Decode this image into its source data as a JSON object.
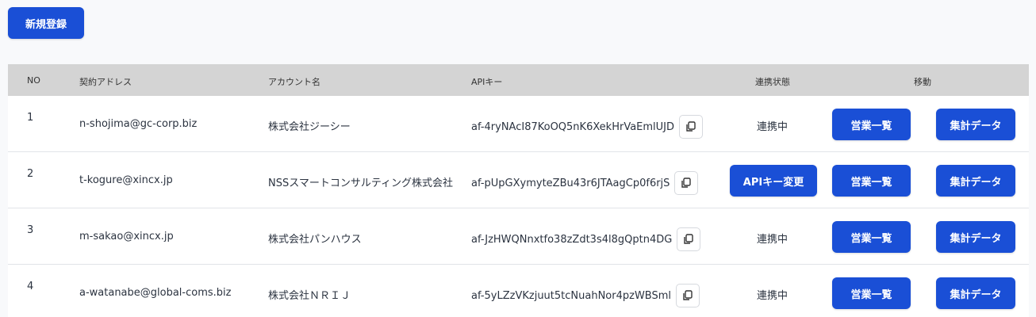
{
  "toolbar": {
    "new_label": "新規登録"
  },
  "colors": {
    "accent": "#1a4fd6",
    "header_bg": "#d4d4d4"
  },
  "table": {
    "headers": {
      "no": "NO",
      "email": "契約アドレス",
      "account": "アカウント名",
      "api": "APIキー",
      "status": "連携状態",
      "move": "移動"
    },
    "rows": [
      {
        "no": "1",
        "email": "n-shojima@gc-corp.biz",
        "account": "株式会社ジーシー",
        "api": "af-4ryNAcI87KoOQ5nK6XekHrVaEmlUJD",
        "status": "連携中",
        "sales": "営業一覧",
        "agg": "集計データ"
      },
      {
        "no": "2",
        "email": "t-kogure@xincx.jp",
        "account": "NSSスマートコンサルティング株式会社",
        "api": "af-pUpGXymyteZBu43r6JTAagCp0f6rjS",
        "api_change": "APIキー変更",
        "sales": "営業一覧",
        "agg": "集計データ"
      },
      {
        "no": "3",
        "email": "m-sakao@xincx.jp",
        "account": "株式会社パンハウス",
        "api": "af-JzHWQNnxtfo38zZdt3s4l8gQptn4DG",
        "status": "連携中",
        "sales": "営業一覧",
        "agg": "集計データ"
      },
      {
        "no": "4",
        "email": "a-watanabe@global-coms.biz",
        "account": "株式会社ＮＲＩＪ",
        "api": "af-5yLZzVKzjuut5tcNuahNor4pzWBSml",
        "status": "連携中",
        "sales": "営業一覧",
        "agg": "集計データ"
      }
    ]
  }
}
